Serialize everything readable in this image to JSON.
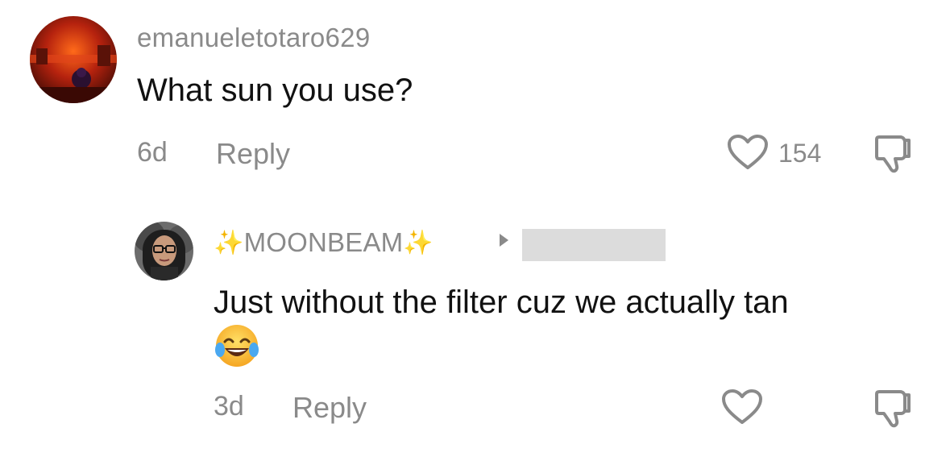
{
  "comments": [
    {
      "username": "emanueletotaro629",
      "text": "What sun you use?",
      "time": "6d",
      "reply_label": "Reply",
      "like_count": "154",
      "avatar_icon": "fiery-scene-avatar"
    },
    {
      "username": "MOONBEAM",
      "username_decoration": "sparkles-icon",
      "text": "Just without the filter cuz we actually tan",
      "emoji": "😂",
      "time": "3d",
      "reply_label": "Reply",
      "like_count": "",
      "avatar_icon": "woman-with-glasses-avatar"
    }
  ],
  "colors": {
    "muted_text": "#8a8a8a",
    "primary_text": "#111111",
    "sparkle": "#f5c518",
    "redaction": "#dcdcdc"
  }
}
